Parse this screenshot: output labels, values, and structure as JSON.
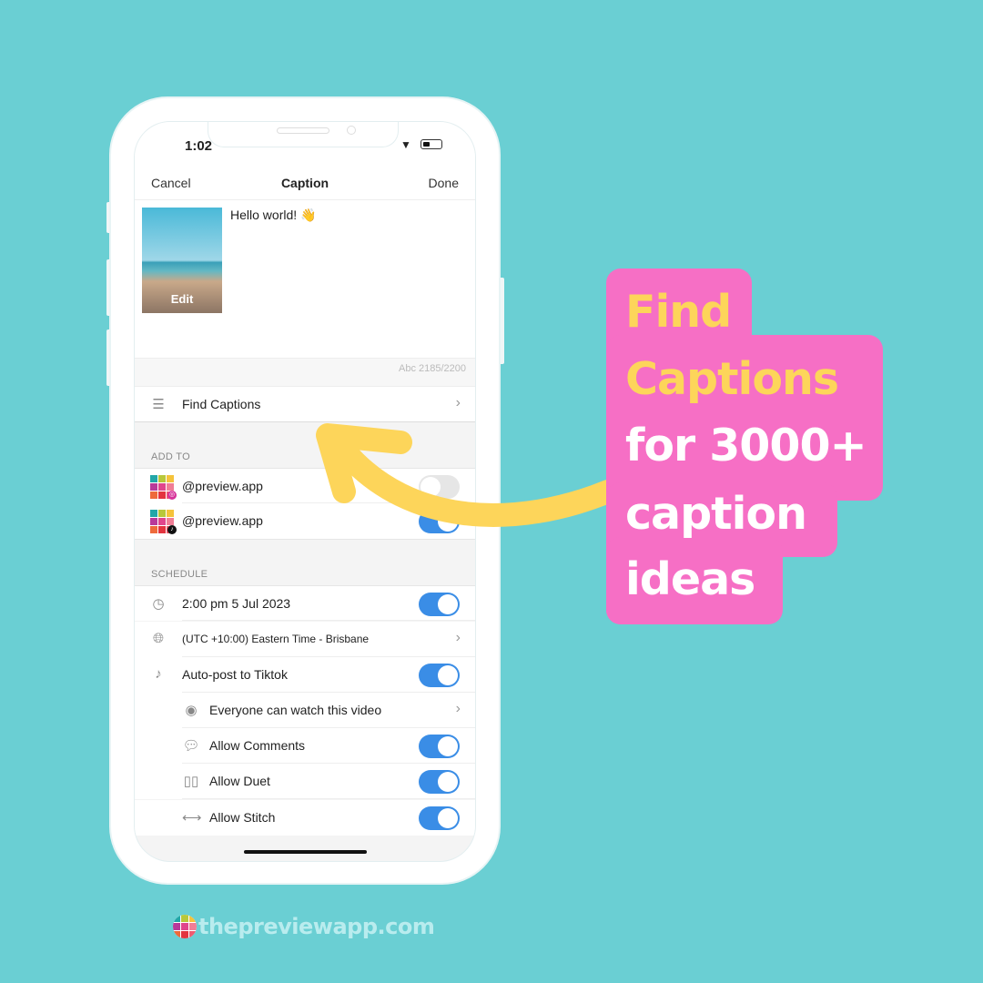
{
  "colors": {
    "background": "#6acfd3",
    "accent_pink": "#f66fc5",
    "accent_yellow": "#fdd55a",
    "toggle_on": "#3a8de6"
  },
  "status_bar": {
    "time": "1:02"
  },
  "nav": {
    "cancel": "Cancel",
    "title": "Caption",
    "done": "Done"
  },
  "caption": {
    "text": "Hello world! 👋",
    "thumb_edit": "Edit",
    "counter": "Abc 2185/2200"
  },
  "find_captions": {
    "label": "Find Captions",
    "icon": "text-lines-icon"
  },
  "add_to": {
    "header": "ADD TO",
    "accounts": [
      {
        "handle": "@preview.app",
        "platform": "instagram",
        "enabled": false
      },
      {
        "handle": "@preview.app",
        "platform": "tiktok",
        "enabled": true
      }
    ]
  },
  "schedule": {
    "header": "SCHEDULE",
    "datetime": {
      "label": "2:00 pm  5 Jul 2023",
      "enabled": true
    },
    "timezone": "(UTC +10:00) Eastern Time - Brisbane",
    "autopost": {
      "label": "Auto-post to Tiktok",
      "enabled": true
    },
    "visibility": "Everyone can watch this video",
    "comments": {
      "label": "Allow Comments",
      "enabled": true
    },
    "duet": {
      "label": "Allow Duet",
      "enabled": true
    },
    "stitch": {
      "label": "Allow Stitch",
      "enabled": true
    }
  },
  "callout": {
    "line1": "Find",
    "line2": "Captions",
    "line3": "for 3000+",
    "line4": "caption",
    "line5": "ideas"
  },
  "footer": {
    "brand": "thepreviewapp.com"
  }
}
